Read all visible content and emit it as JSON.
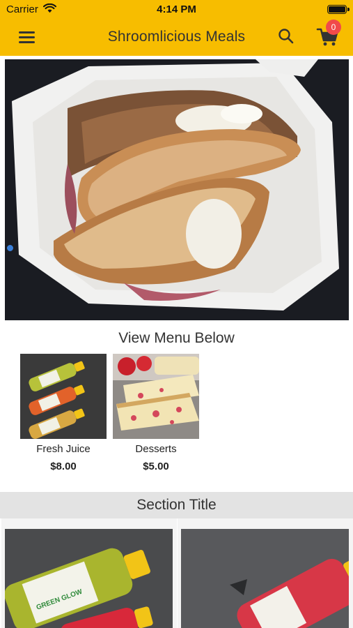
{
  "status_bar": {
    "carrier": "Carrier",
    "time": "4:14 PM"
  },
  "header": {
    "title": "Shroomlicious Meals",
    "cart_count": "0"
  },
  "hero": {
    "image": "grilled-sandwich-photo"
  },
  "menu": {
    "heading": "View Menu Below",
    "items": [
      {
        "label": "Fresh Juice",
        "price": "$8.00",
        "image": "juice-bottles-photo"
      },
      {
        "label": "Desserts",
        "price": "$5.00",
        "image": "strawberry-pound-cake-photo"
      }
    ]
  },
  "section": {
    "title": "Section Title",
    "products": [
      {
        "image": "green-juice-bottle-photo",
        "bottle_label": "GREEN GLOW"
      },
      {
        "image": "red-juice-bottle-photo"
      }
    ]
  },
  "colors": {
    "header": "#f7bd00",
    "badge": "#f14a4a",
    "section_bar": "#e3e3e3"
  },
  "icons": [
    "wifi-icon",
    "battery-icon",
    "hamburger-menu-icon",
    "search-icon",
    "shopping-cart-icon"
  ]
}
